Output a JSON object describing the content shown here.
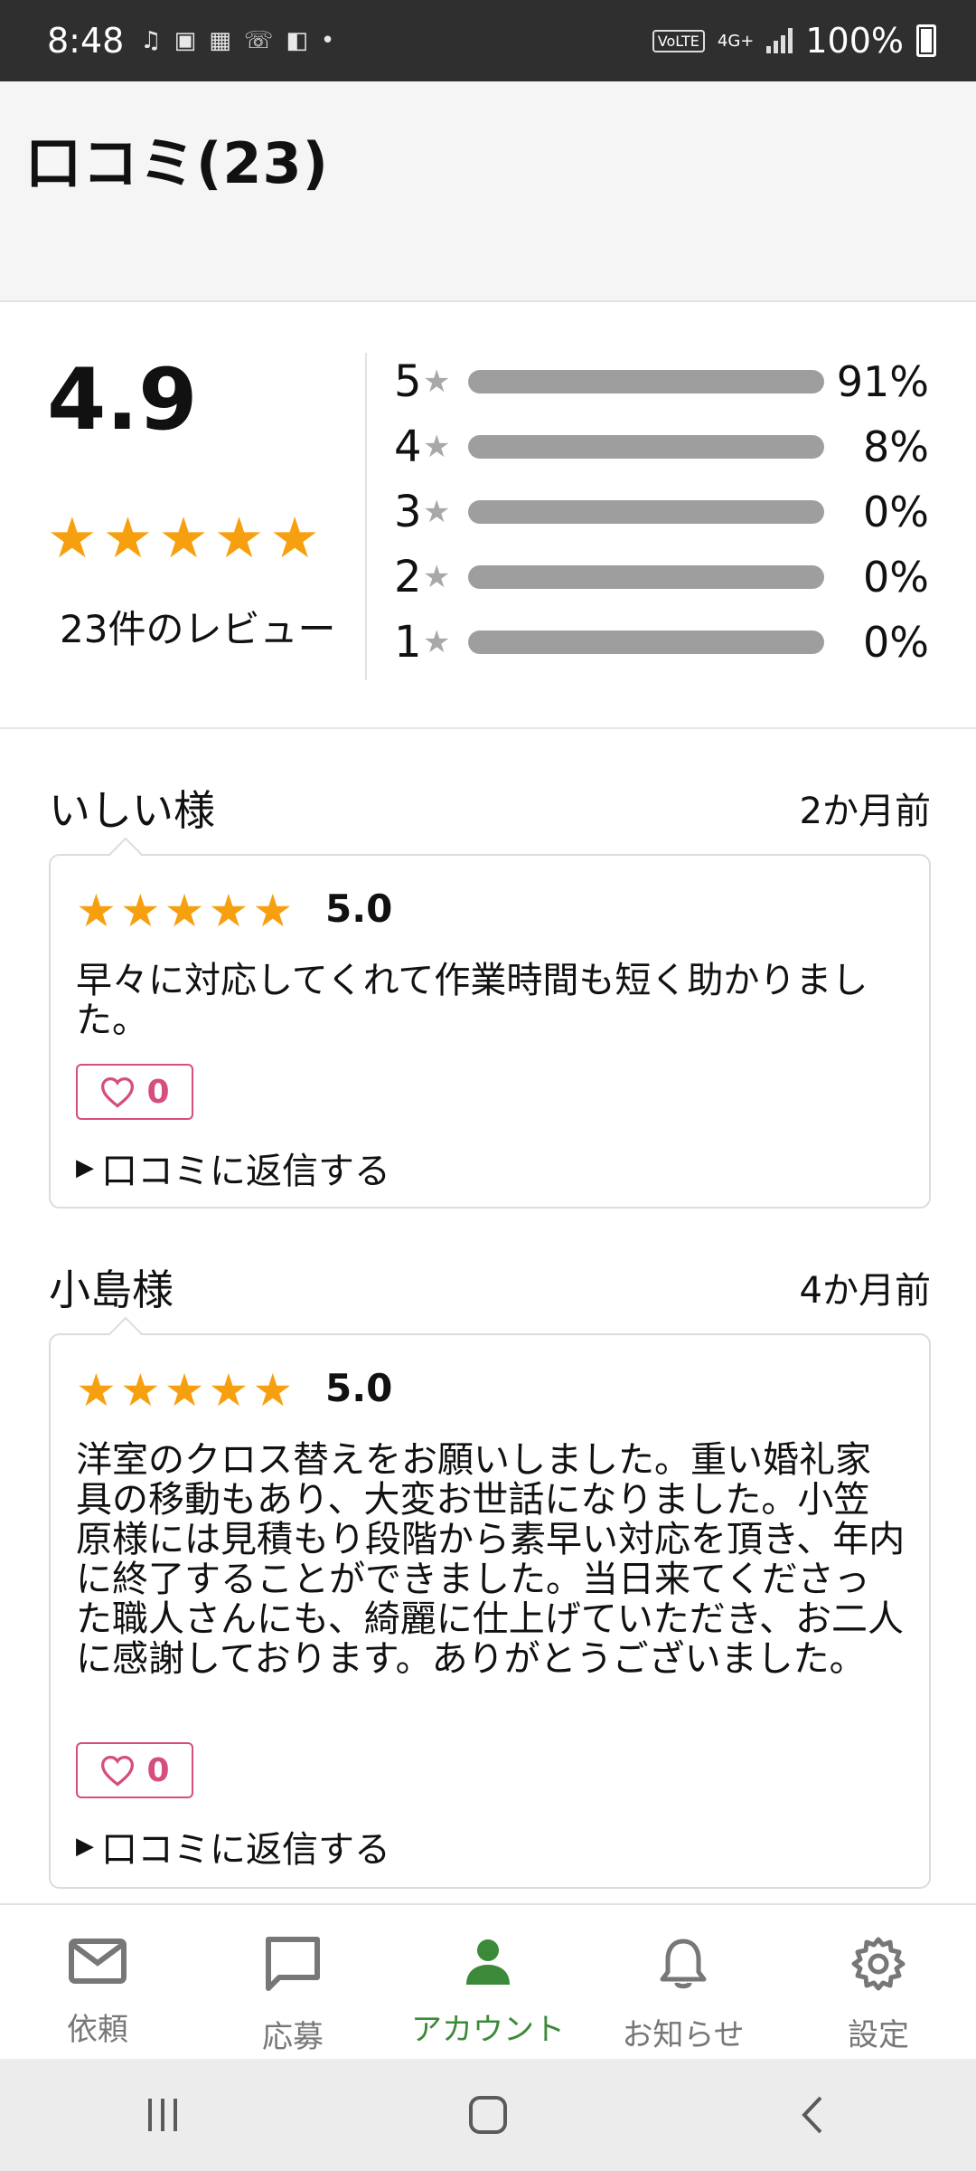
{
  "status_bar": {
    "time": "8:48",
    "volte": "VoLTE",
    "network": "4G+",
    "battery": "100%"
  },
  "header": {
    "title": "口コミ(23)"
  },
  "summary": {
    "average": "4.9",
    "stars": 5,
    "review_count_label": "23件のレビュー",
    "distribution": [
      {
        "stars": "5",
        "percent": 91,
        "label": "91%"
      },
      {
        "stars": "4",
        "percent": 8,
        "label": "8%"
      },
      {
        "stars": "3",
        "percent": 0,
        "label": "0%"
      },
      {
        "stars": "2",
        "percent": 0,
        "label": "0%"
      },
      {
        "stars": "1",
        "percent": 0,
        "label": "0%"
      }
    ]
  },
  "reviews": [
    {
      "name": "いしい様",
      "date": "2か月前",
      "score": "5.0",
      "text": "早々に対応してくれて作業時間も短く助かりました。",
      "likes": "0",
      "reply_label": "口コミに返信する"
    },
    {
      "name": "小島様",
      "date": "4か月前",
      "score": "5.0",
      "text": "洋室のクロス替えをお願いしました。重い婚礼家具の移動もあり、大変お世話になりました。小笠原様には見積もり段階から素早い対応を頂き、年内に終了することができました。当日来てくださった職人さんにも、綺麗に仕上げていただき、お二人に感謝しております。ありがとうございました。",
      "likes": "0",
      "reply_label": "口コミに返信する"
    }
  ],
  "bottom_nav": [
    {
      "label": "依頼",
      "icon": "mail-icon",
      "active": false
    },
    {
      "label": "応募",
      "icon": "chat-icon",
      "active": false
    },
    {
      "label": "アカウント",
      "icon": "person-icon",
      "active": true
    },
    {
      "label": "お知らせ",
      "icon": "bell-icon",
      "active": false
    },
    {
      "label": "設定",
      "icon": "gear-icon",
      "active": false
    }
  ],
  "colors": {
    "accent_star": "#f7a00f",
    "active_nav": "#3b8a3a",
    "like": "#d64d7f"
  }
}
